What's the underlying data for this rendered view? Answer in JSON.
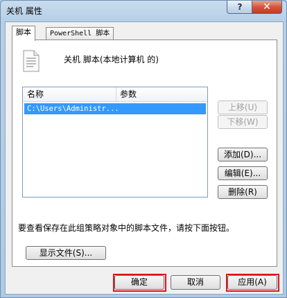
{
  "window": {
    "title": "关机 属性",
    "help_label": "?",
    "close_label": "✕"
  },
  "tabs": [
    {
      "label": "脚本",
      "active": true
    },
    {
      "label": "PowerShell 脚本",
      "active": false
    }
  ],
  "panel": {
    "heading": "关机 脚本(本地计算机 的)",
    "icon": "script-document-icon",
    "list": {
      "columns": [
        "名称",
        "参数"
      ],
      "rows": [
        {
          "name": "C:\\Users\\Administr...",
          "params": "",
          "selected": true
        }
      ]
    },
    "buttons": {
      "up": "上移(U)",
      "down": "下移(W)",
      "add": "添加(D)...",
      "edit": "编辑(E)...",
      "delete": "删除(R)"
    },
    "info_text": "要查看保存在此组策略对象中的脚本文件，请按下面按钮。",
    "show_files": "显示文件(S)..."
  },
  "footer": {
    "ok": "确定",
    "cancel": "取消",
    "apply": "应用(A)"
  },
  "colors": {
    "highlight": "#e0141a",
    "selection": "#3399ff"
  }
}
